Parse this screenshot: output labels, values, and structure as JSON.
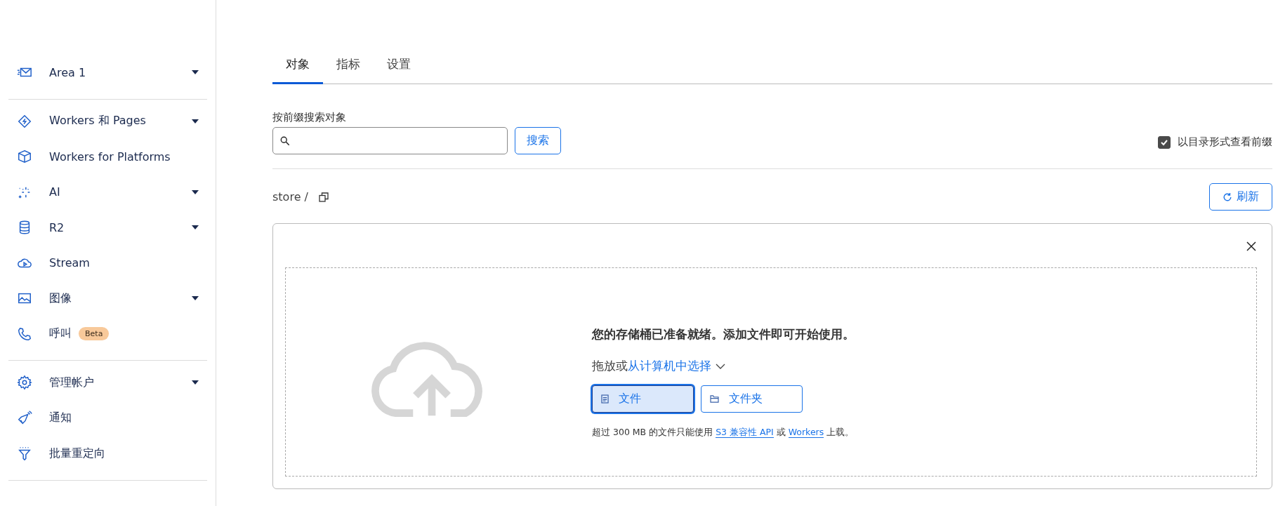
{
  "sidebar": {
    "groups": [
      {
        "items": [
          {
            "label": "Area 1",
            "expandable": true
          }
        ]
      },
      {
        "items": [
          {
            "label": "Workers 和 Pages",
            "expandable": true
          },
          {
            "label": "Workers for Platforms",
            "expandable": false
          },
          {
            "label": "AI",
            "expandable": true
          },
          {
            "label": "R2",
            "expandable": true
          },
          {
            "label": "Stream",
            "expandable": false
          },
          {
            "label": "图像",
            "expandable": true
          },
          {
            "label": "呼叫",
            "expandable": false,
            "badge": "Beta"
          }
        ]
      },
      {
        "items": [
          {
            "label": "管理帐户",
            "expandable": true
          },
          {
            "label": "通知",
            "expandable": false
          },
          {
            "label": "批量重定向",
            "expandable": false
          }
        ]
      }
    ]
  },
  "tabs": [
    {
      "label": "对象",
      "selected": true
    },
    {
      "label": "指标",
      "selected": false
    },
    {
      "label": "设置",
      "selected": false
    }
  ],
  "search": {
    "label": "按前缀搜索对象",
    "button": "搜索"
  },
  "directory_view": {
    "label": "以目录形式查看前缀",
    "checked": true
  },
  "path": "store /",
  "refresh_button": "刷新",
  "upload": {
    "title": "您的存储桶已准备就绪。添加文件即可开始使用。",
    "drag_text": "拖放或",
    "select_link": "从计算机中选择",
    "buttons": [
      {
        "label": "文件",
        "selected": true
      },
      {
        "label": "文件夹",
        "selected": false
      }
    ],
    "note": [
      {
        "kind": "text",
        "text": "超过 300 MB 的文件只能使用 "
      },
      {
        "kind": "link",
        "text": "S3 兼容性 API"
      },
      {
        "kind": "text",
        "text": " 或 "
      },
      {
        "kind": "link",
        "text": "Workers"
      },
      {
        "kind": "text",
        "text": " 上载。"
      }
    ]
  }
}
